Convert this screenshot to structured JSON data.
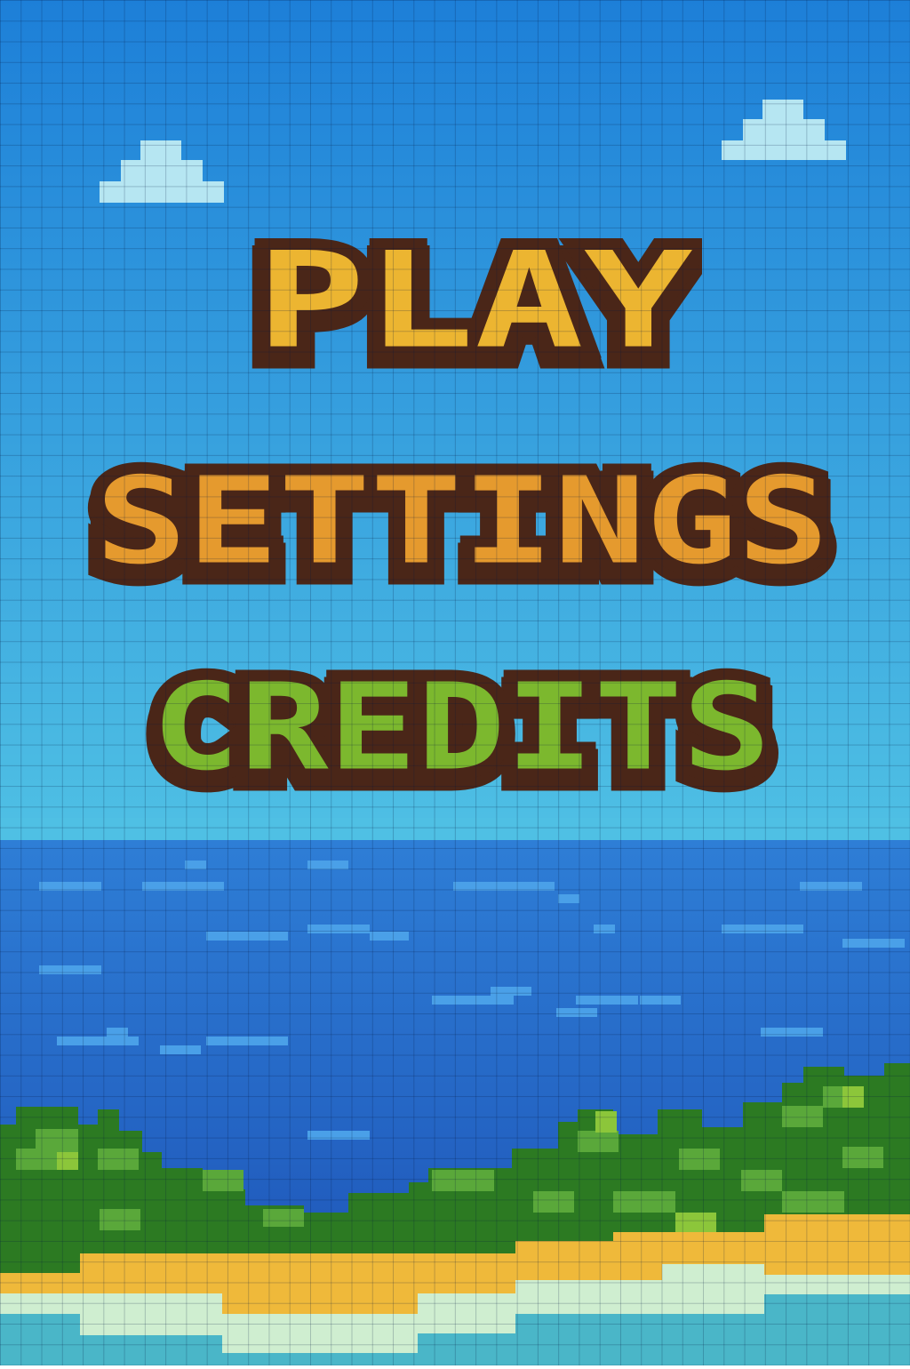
{
  "menu": {
    "items": [
      {
        "id": "play",
        "label": "PLAY",
        "fill": "#ecb531",
        "outline": "#4a2618",
        "accent": "#ecb531"
      },
      {
        "id": "settings",
        "label": "SETTINGS",
        "fill": "#e59a2e",
        "outline": "#4a2618",
        "accent": "#8cc63a"
      },
      {
        "id": "credits",
        "label": "CREDITS",
        "fill": "#7cb82e",
        "outline": "#4a2618",
        "accent": "#2f8a2a"
      }
    ]
  },
  "palette": {
    "sky_top": "#1d7fd8",
    "sky_bottom": "#4fc0e4",
    "horizon": "#35a8d8",
    "sea_light": "#2e7ed6",
    "sea_dark": "#1c4fb4",
    "wave": "#4aa0e8",
    "cloud": "#b6e6f2",
    "cloud_shadow": "#8fd2e8",
    "grass_dark": "#2c7a22",
    "grass_light": "#5aa83a",
    "sand": "#efb93a",
    "foam": "#cfeed0",
    "shallow": "#4ab6c8"
  },
  "icons": [
    "cloud-icon"
  ]
}
